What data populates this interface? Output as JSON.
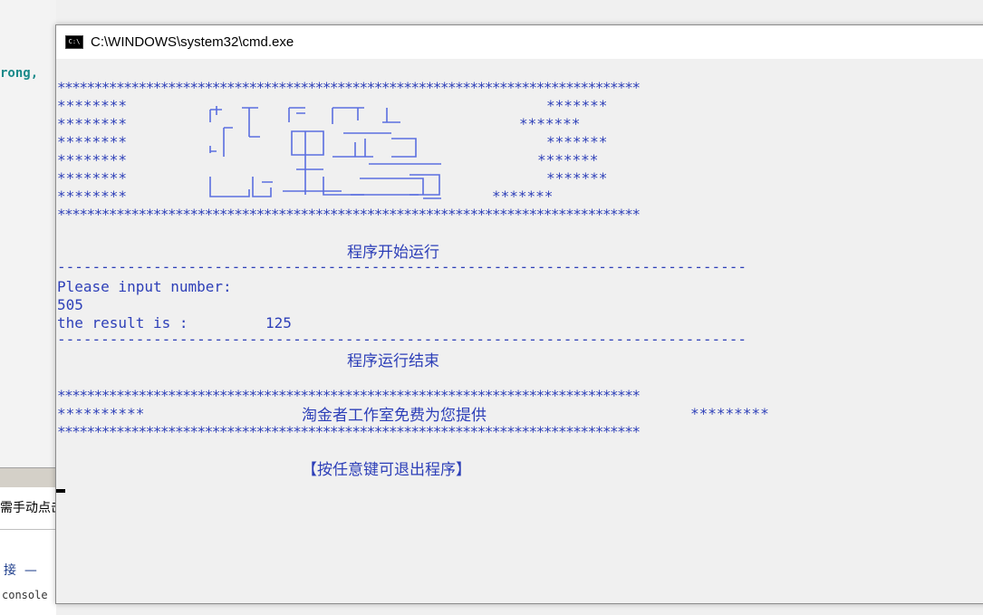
{
  "background": {
    "code_fragment": "rong, ",
    "panel_text": "需手动点击",
    "link_text": "接  —",
    "console_label": "console"
  },
  "window": {
    "title": "C:\\WINDOWS\\system32\\cmd.exe",
    "icon": "cmd-icon"
  },
  "console": {
    "star_line": "*******************************************************************************",
    "banner_left": "********",
    "banner_right": [
      "*******",
      "*******",
      "*******",
      "*******",
      "*******",
      "*******"
    ],
    "start_msg": "程序开始运行",
    "dash_line": "-------------------------------------------------------------------------------",
    "prompt": "Please input number:",
    "input_value": "505",
    "result_label": "the result is :",
    "result_value": "125",
    "end_msg": "程序运行结束",
    "footer_left": "**********",
    "footer_text": "淘金者工作室免费为您提供",
    "footer_right": "*********",
    "exit_msg": "【按任意键可退出程序】"
  },
  "colors": {
    "console_text": "#2d3fb8",
    "console_bg": "#f0f0f0"
  }
}
